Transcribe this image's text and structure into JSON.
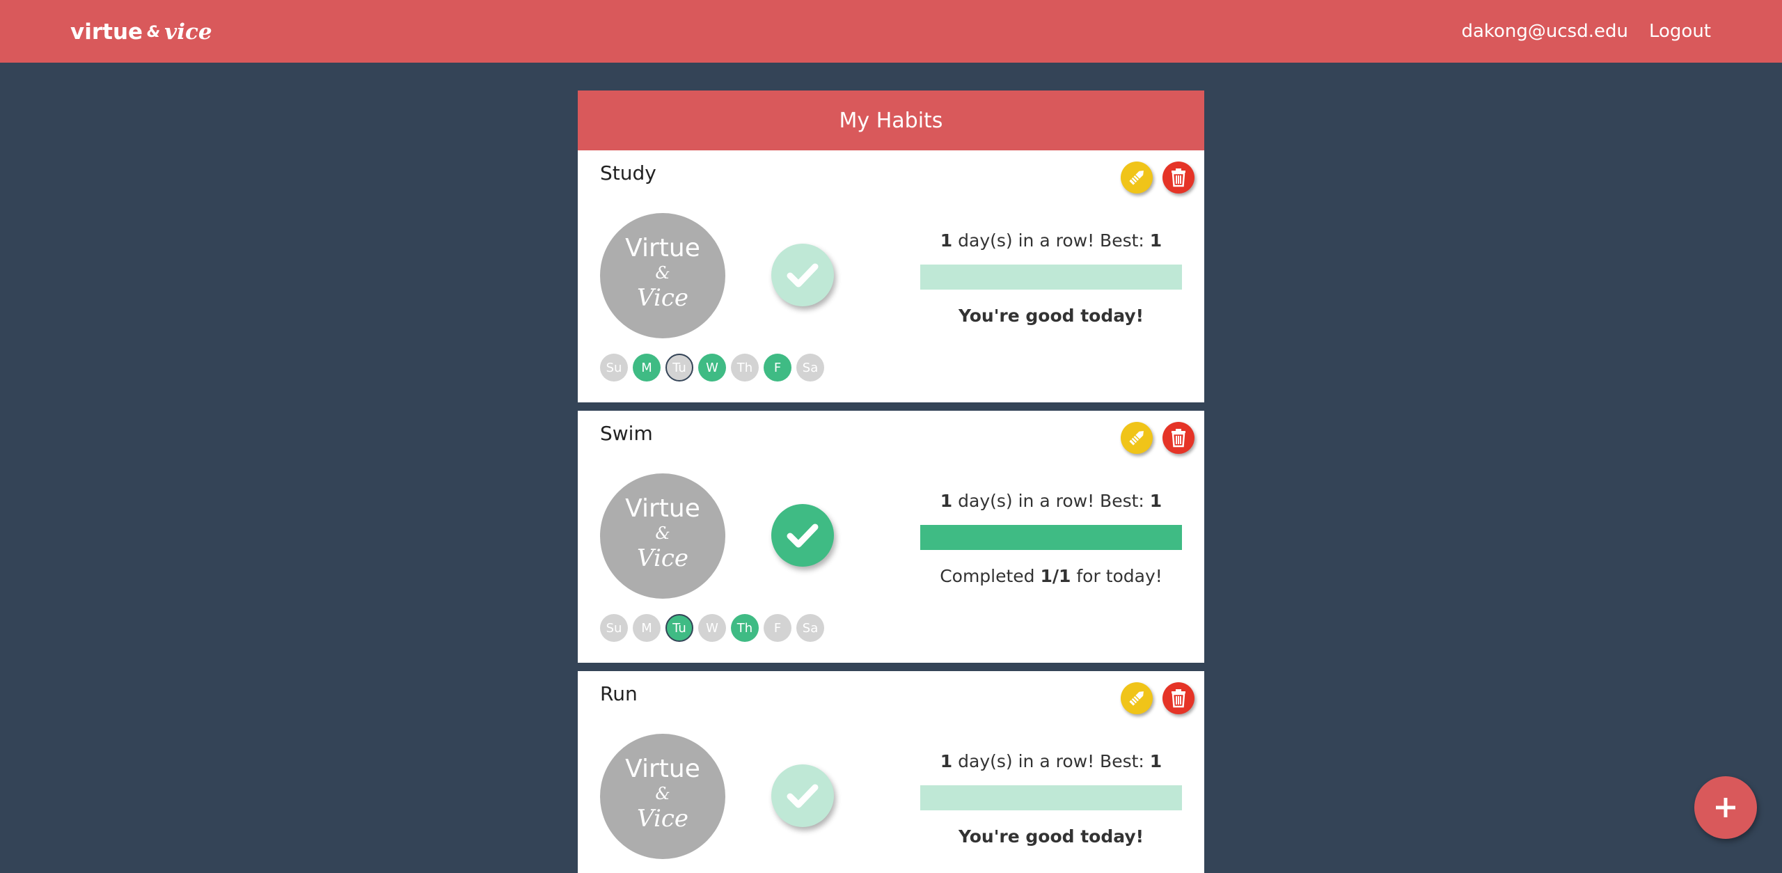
{
  "nav": {
    "brand_virtue": "virtue",
    "brand_amp": "&",
    "brand_vice": "vice",
    "user_email": "dakong@ucsd.edu",
    "logout_label": "Logout"
  },
  "panel": {
    "title": "My Habits"
  },
  "avatar_text": {
    "line1": "Virtue",
    "line2": "&",
    "line3": "Vice"
  },
  "habits": [
    {
      "name": "Study",
      "streak_current": "1",
      "streak_text_mid": " day(s) in a row! Best: ",
      "streak_best": "1",
      "progress_fraction": 0,
      "status_text": "You're good today!",
      "check_state": "pending",
      "days": [
        {
          "label": "Su",
          "active": false,
          "today": false
        },
        {
          "label": "M",
          "active": true,
          "today": false
        },
        {
          "label": "Tu",
          "active": false,
          "today": true
        },
        {
          "label": "W",
          "active": true,
          "today": false
        },
        {
          "label": "Th",
          "active": false,
          "today": false
        },
        {
          "label": "F",
          "active": true,
          "today": false
        },
        {
          "label": "Sa",
          "active": false,
          "today": false
        }
      ]
    },
    {
      "name": "Swim",
      "streak_current": "1",
      "streak_text_mid": " day(s) in a row! Best: ",
      "streak_best": "1",
      "progress_fraction": 1,
      "status_prefix": "Completed ",
      "status_count": "1/1",
      "status_suffix": " for today!",
      "check_state": "done",
      "days": [
        {
          "label": "Su",
          "active": false,
          "today": false
        },
        {
          "label": "M",
          "active": false,
          "today": false
        },
        {
          "label": "Tu",
          "active": true,
          "today": true
        },
        {
          "label": "W",
          "active": false,
          "today": false
        },
        {
          "label": "Th",
          "active": true,
          "today": false
        },
        {
          "label": "F",
          "active": false,
          "today": false
        },
        {
          "label": "Sa",
          "active": false,
          "today": false
        }
      ]
    },
    {
      "name": "Run",
      "streak_current": "1",
      "streak_text_mid": " day(s) in a row! Best: ",
      "streak_best": "1",
      "progress_fraction": 0,
      "status_text": "You're good today!",
      "check_state": "pending"
    }
  ],
  "colors": {
    "brand_red": "#d9595b",
    "background": "#344457",
    "success_green": "#3fbb84",
    "success_light": "#bfe8d6",
    "edit_yellow": "#f0c419",
    "delete_red": "#e53427",
    "day_off": "#d3d3d3"
  },
  "icons": {
    "edit": "pencil-icon",
    "delete": "trash-icon",
    "check": "checkmark-icon",
    "add": "plus-icon"
  }
}
